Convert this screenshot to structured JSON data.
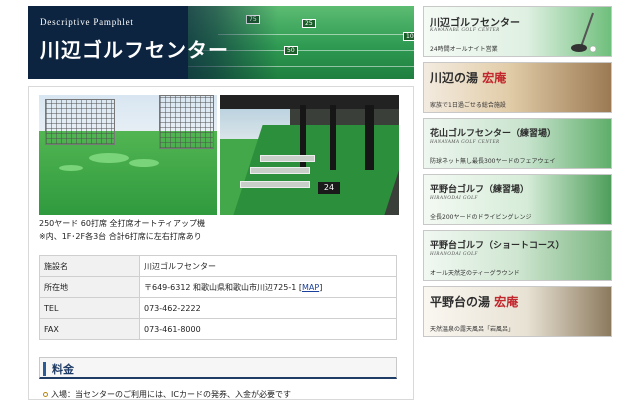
{
  "header": {
    "eyebrow": "Descriptive Pamphlet",
    "title": "川辺ゴルフセンター",
    "sign_labels": [
      "50",
      "100",
      "150",
      "75",
      "25"
    ]
  },
  "main": {
    "caption_line1": "250ヤード 60打席 全打席オートティアップ機",
    "caption_line2": "※内、1F･2F各3台 合計6打席に左右打席あり",
    "photo_tee_number": "24",
    "info_table": [
      {
        "label": "施設名",
        "value": "川辺ゴルフセンター"
      },
      {
        "label": "所在地",
        "value": "〒649-6312 和歌山県和歌山市川辺725-1",
        "link": "MAP"
      },
      {
        "label": "TEL",
        "value": "073-462-2222"
      },
      {
        "label": "FAX",
        "value": "073-461-8000"
      }
    ],
    "section_title": "料金",
    "section_text": "入場：当センターのご利用には、ICカードの発券、入金が必要です"
  },
  "sidebar": {
    "cards": [
      {
        "title": "川辺ゴルフセンター",
        "subtitle": "KAWANABE GOLF CENTER",
        "desc": "24時間オールナイト営業",
        "bg": "#dff0e2"
      },
      {
        "title_main": "川辺の湯",
        "title_accent": "宏庵",
        "desc": "家族で1日過ごせる総合施設",
        "bg": "#c9a77f"
      },
      {
        "title": "花山ゴルフセンター（練習場）",
        "subtitle": "HANAYAMA GOLF CENTER",
        "desc": "防球ネット無し最長300ヤードのフェアウェイ",
        "bg": "#c7e3cd"
      },
      {
        "title": "平野台ゴルフ（練習場）",
        "subtitle": "HIRANODAI GOLF",
        "desc": "全長200ヤードのドライビングレンジ",
        "bg": "#d6ecd8"
      },
      {
        "title": "平野台ゴルフ（ショートコース）",
        "subtitle": "HIRANODAI GOLF",
        "desc": "オール天然芝のティーグラウンド",
        "bg": "#cfe6d1"
      },
      {
        "title_main": "平野台の湯",
        "title_accent": "宏庵",
        "desc": "天然温泉の露天風呂「岩風呂」",
        "bg": "#e8e2d4"
      }
    ]
  }
}
